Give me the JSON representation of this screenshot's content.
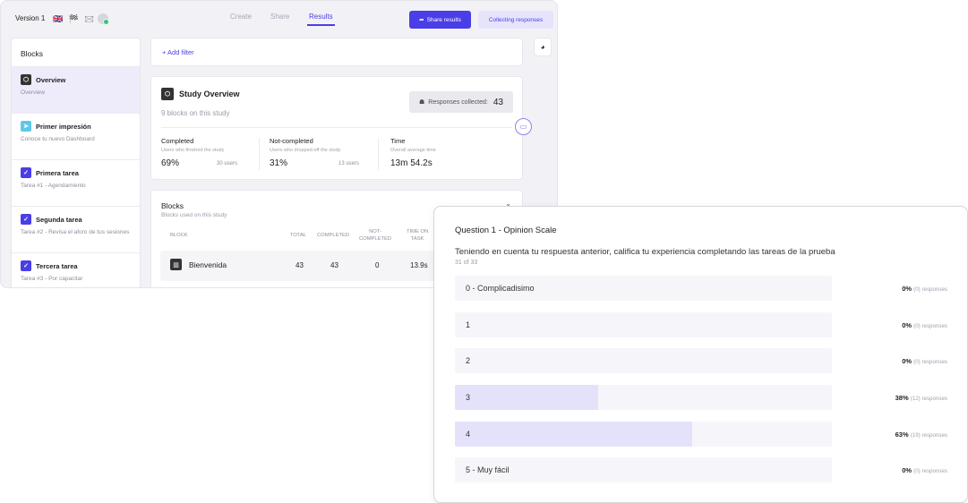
{
  "topbar": {
    "version": "Version 1",
    "flags": "🇬🇧 🏁 🖂",
    "tabs": [
      "Create",
      "Share",
      "Results"
    ],
    "active_tab": "Results",
    "share_button": "Share results",
    "collect_button": "Collecting responses"
  },
  "sidebar": {
    "title": "Blocks",
    "items": [
      {
        "icon": "cube-icon",
        "icon_color": "#333333",
        "title": "Overview",
        "subtitle": "Overview"
      },
      {
        "icon": "cursor-icon",
        "icon_color": "#5ec7e8",
        "title": "Primer impresión",
        "subtitle": "Conoce tu nuevo Dashboard"
      },
      {
        "icon": "check-icon",
        "icon_color": "#4a3ee6",
        "title": "Primera tarea",
        "subtitle": "Tarea #1 - Agendamiento"
      },
      {
        "icon": "check-icon",
        "icon_color": "#4a3ee6",
        "title": "Segunda tarea",
        "subtitle": "Tarea #2 - Revisa el aforo de tus sesiones"
      },
      {
        "icon": "check-icon",
        "icon_color": "#4a3ee6",
        "title": "Tercera tarea",
        "subtitle": "Tarea #3 - Por capacitar"
      }
    ]
  },
  "filter": {
    "add_label": "+ Add filter"
  },
  "overview": {
    "title": "Study Overview",
    "subtitle": "9 blocks on this study",
    "responses_label": "Responses collected:",
    "responses_count": "43",
    "stats": [
      {
        "label": "Completed",
        "desc": "Users who finished the study",
        "value": "69%",
        "users": "30 users"
      },
      {
        "label": "Not-completed",
        "desc": "Users who dropped-off the study",
        "value": "31%",
        "users": "13 users"
      },
      {
        "label": "Time",
        "desc": "Overall average time",
        "value": "13m 54.2s",
        "users": ""
      }
    ]
  },
  "blocks_table": {
    "title": "Blocks",
    "subtitle": "Blocks used on this study",
    "headers": {
      "block": "BLOCK",
      "total": "TOTAL",
      "completed": "COMPLETED",
      "not_completed_1": "NOT-",
      "not_completed_2": "COMPLETED",
      "time_1": "TIME ON",
      "time_2": "TASK"
    },
    "rows": [
      {
        "name": "Bienvenida",
        "total": "43",
        "completed": "43",
        "not_completed": "0",
        "time": "13.9s"
      }
    ]
  },
  "question": {
    "title": "Question 1 - Opinion Scale",
    "text": "Teniendo en cuenta tu respuesta anterior, califica tu experiencia completando las tareas de la prueba",
    "count": "31 of 33",
    "options": [
      {
        "label": "0 - Complicadisimo",
        "percent": 0,
        "pct_text": "0%",
        "responses": "(0) responses"
      },
      {
        "label": "1",
        "percent": 0,
        "pct_text": "0%",
        "responses": "(0) responses"
      },
      {
        "label": "2",
        "percent": 0,
        "pct_text": "0%",
        "responses": "(0) responses"
      },
      {
        "label": "3",
        "percent": 38,
        "pct_text": "38%",
        "responses": "(12) responses"
      },
      {
        "label": "4",
        "percent": 63,
        "pct_text": "63%",
        "responses": "(19) responses"
      },
      {
        "label": "5 - Muy fácil",
        "percent": 0,
        "pct_text": "0%",
        "responses": "(0) responses"
      }
    ]
  },
  "colors": {
    "accent": "#4a3ee6",
    "fill": "#e4e2fb"
  }
}
